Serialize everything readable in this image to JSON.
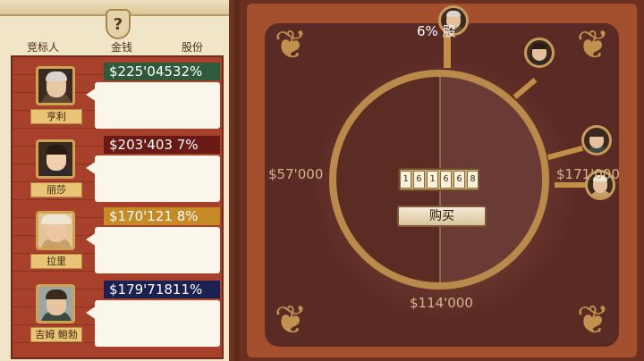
{
  "help": {
    "icon": "question-mark-icon",
    "glyph": "?"
  },
  "columns": {
    "bidder": "竞标人",
    "money": "金钱",
    "shares": "股份"
  },
  "bidders": [
    {
      "name": "亨利",
      "money_text": "$225'04532%",
      "money_color": "#2f5a3b",
      "portrait": "henry-portrait"
    },
    {
      "name": "丽莎",
      "money_text": "$203'403 7%",
      "money_color": "#6a1a14",
      "portrait": "lisa-portrait"
    },
    {
      "name": "拉里",
      "money_text": "$170'121 8%",
      "money_color": "#c68a26",
      "portrait": "larry-portrait"
    },
    {
      "name": "吉姆 鲍勃",
      "money_text": "$179'71811%",
      "money_color": "#1b2150",
      "portrait": "jim-bob-portrait"
    }
  ],
  "board": {
    "shares_offered": "6% 股",
    "values": {
      "left": "$57'000",
      "right": "$171'000",
      "bottom": "$114'000"
    },
    "bid_digits": [
      "1",
      "6",
      "1",
      "6",
      "6",
      "8"
    ],
    "buy_label": "购买"
  }
}
